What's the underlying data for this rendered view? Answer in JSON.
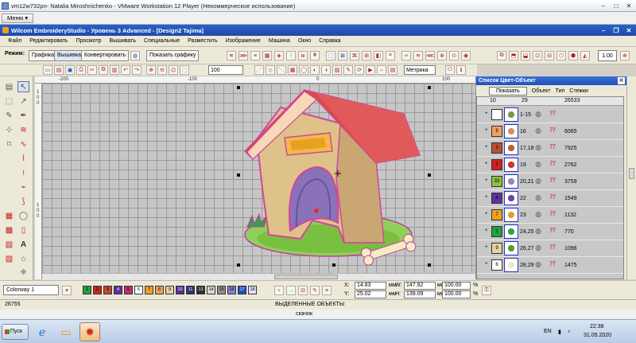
{
  "vm": {
    "title": "vm12w732pn- Natalia Miroshnichenko - VMware Workstation 12 Player (Некоммерческое использование)",
    "menu_button": "Меню ▾",
    "status_right": "скачок"
  },
  "app": {
    "title": "Wilcom EmbroideryStudio - Уровень 3 Advanced - [Design2     Tajima]",
    "menu": [
      "Файл",
      "Редактировать",
      "Просмотр",
      "Вышивать",
      "Специальные",
      "Разместить",
      "Изображение",
      "Машина",
      "Окно",
      "Справка"
    ]
  },
  "toolbar": {
    "mode_label": "Режим:",
    "mode_graphics": "Графика",
    "mode_embroidery": "Вышивка",
    "mode_convert": "Конвертировать",
    "show_graphics": "Показать графику",
    "zoom_value": "100",
    "units_value": "Метрика",
    "scale_value": "1.00"
  },
  "rulers": {
    "top": [
      "-200",
      "-100",
      "0",
      "100"
    ],
    "left": [
      "1",
      "0",
      "0",
      "1",
      "0",
      "0"
    ]
  },
  "color_panel": {
    "title": "Список Цвет-Объект",
    "show_button": "Показать",
    "col_object": "Объект",
    "col_type": "Тип",
    "col_stitches": "Стежки",
    "count_colors": "10",
    "count_objects": "29",
    "count_stitches": "26533",
    "rows": [
      {
        "num": "",
        "swatch": "#ffffff",
        "range": "1-15",
        "stitches": "",
        "thumb": "#7a9a40"
      },
      {
        "num": "8",
        "swatch": "#f0a060",
        "range": "16",
        "stitches": "6065",
        "thumb": "#d89060"
      },
      {
        "num": "3",
        "swatch": "#b85030",
        "range": "17,18",
        "stitches": "7925",
        "thumb": "#c06030"
      },
      {
        "num": "2",
        "swatch": "#d02020",
        "range": "19",
        "stitches": "2762",
        "thumb": "#d03030"
      },
      {
        "num": "33",
        "swatch": "#8cc040",
        "range": "20,21",
        "stitches": "3759",
        "thumb": "#9a80c0"
      },
      {
        "num": "4",
        "swatch": "#6030a0",
        "range": "22",
        "stitches": "1549",
        "thumb": "#7040a8"
      },
      {
        "num": "7",
        "swatch": "#f0a020",
        "range": "23",
        "stitches": "1132",
        "thumb": "#e0a030"
      },
      {
        "num": "1",
        "swatch": "#20a040",
        "range": "24,25",
        "stitches": "770",
        "thumb": "#30a050"
      },
      {
        "num": "9",
        "swatch": "#e8d0a0",
        "range": "26,27",
        "stitches": "1096",
        "thumb": "#50a030"
      },
      {
        "num": "6",
        "swatch": "#ffffff",
        "range": "28,29",
        "stitches": "1475",
        "thumb": "#f0e8c0"
      }
    ]
  },
  "bottom": {
    "colorway": "Colorway 1",
    "palette": [
      {
        "n": "1",
        "c": "#20a040"
      },
      {
        "n": "2",
        "c": "#d02020"
      },
      {
        "n": "3",
        "c": "#b85030"
      },
      {
        "n": "4",
        "c": "#6030a0"
      },
      {
        "n": "5",
        "c": "#c03070"
      },
      {
        "n": "6",
        "c": "#ffffff"
      },
      {
        "n": "7",
        "c": "#f0a020"
      },
      {
        "n": "8",
        "c": "#f0a060"
      },
      {
        "n": "9",
        "c": "#e8d0a0"
      },
      {
        "n": "10",
        "c": "#5030a0"
      },
      {
        "n": "11",
        "c": "#303070"
      },
      {
        "n": "13",
        "c": "#303030"
      },
      {
        "n": "14",
        "c": "#d8d8d8"
      },
      {
        "n": "15",
        "c": "#909090"
      },
      {
        "n": "16",
        "c": "#8080d0"
      },
      {
        "n": "17",
        "c": "#2050c0"
      },
      {
        "n": "18",
        "c": "#e0e0ff"
      }
    ],
    "x_label": "X:",
    "x_value": "14.83",
    "y_label": "Y:",
    "y_value": "25.02",
    "w_label": "W:",
    "w_value": "147.92",
    "h_label": "H:",
    "h_value": "139.09",
    "unit": "мм",
    "pct1": "100.00",
    "pct2": "100.00",
    "pct_unit": "%"
  },
  "status": {
    "stitch_count": "26755",
    "selected": "ВЫДЕЛЕННЫЕ ОБЪЕКТЫ"
  },
  "taskbar": {
    "start": "Пуск",
    "lang": "EN",
    "time": "22:38",
    "date": "31.05.2020"
  }
}
